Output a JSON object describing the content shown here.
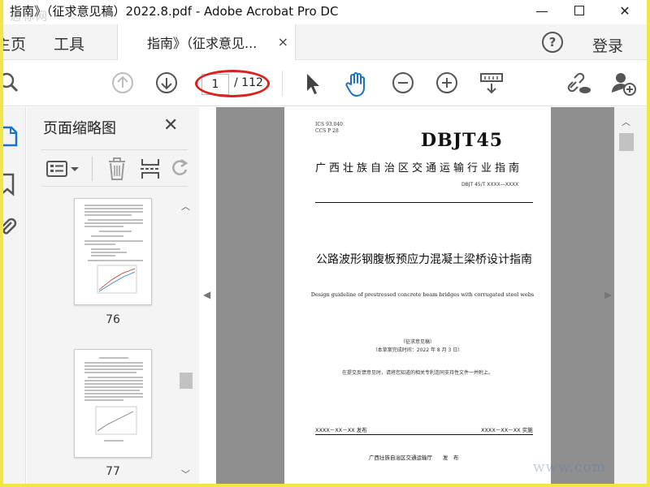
{
  "window": {
    "title": "指南》（征求意见稿）2022.8.pdf - Adobe Acrobat Pro DC",
    "minimize": "—",
    "maximize": "☐",
    "close": "✕"
  },
  "watermark": {
    "top": "通标网",
    "bottom": "www.com"
  },
  "tabs": {
    "home": "主页",
    "tools": "工具",
    "document": "指南》（征求意见...",
    "close": "×",
    "help": "?",
    "login": "登录"
  },
  "toolbar": {
    "page_current": "1",
    "page_total": "/ 112",
    "icons": [
      "search-icon",
      "page-up-icon",
      "page-down-icon",
      "select-cursor-icon",
      "hand-tool-icon",
      "zoom-out-icon",
      "zoom-in-icon",
      "page-layout-icon",
      "share-link-icon",
      "add-user-icon"
    ],
    "accent": "#1a73c8",
    "highlight": "#d8231f"
  },
  "thumbnails_panel": {
    "title": "页面缩略图",
    "close": "✕",
    "pages": [
      {
        "label": "76"
      },
      {
        "label": "77"
      }
    ]
  },
  "document": {
    "ics": "ICS  93.040",
    "ccs": "CCS  P 28",
    "brand": "DBJT45",
    "agency": "广西壮族自治区交通运输行业指南",
    "standard_code": "DBJT  45/T  XXXX—XXXX",
    "title_zh": "公路波形钢腹板预应力混凝土梁桥设计指南",
    "title_en": "Design guideline of prestressed concrete beam bridges with corrugated steel webs",
    "draft_label": "（征求意见稿）",
    "draft_date": "（本草案完成时间：2022 年 8 月 3 日）",
    "notice": "在提交反馈意见时，请将您知道的相关专利连同支持性文件一并附上。",
    "issue_date": "XXXX－XX－XX 发布",
    "impl_date": "XXXX－XX－XX 实施",
    "issuer": "广西壮族自治区交通运输厅　　发　布"
  }
}
